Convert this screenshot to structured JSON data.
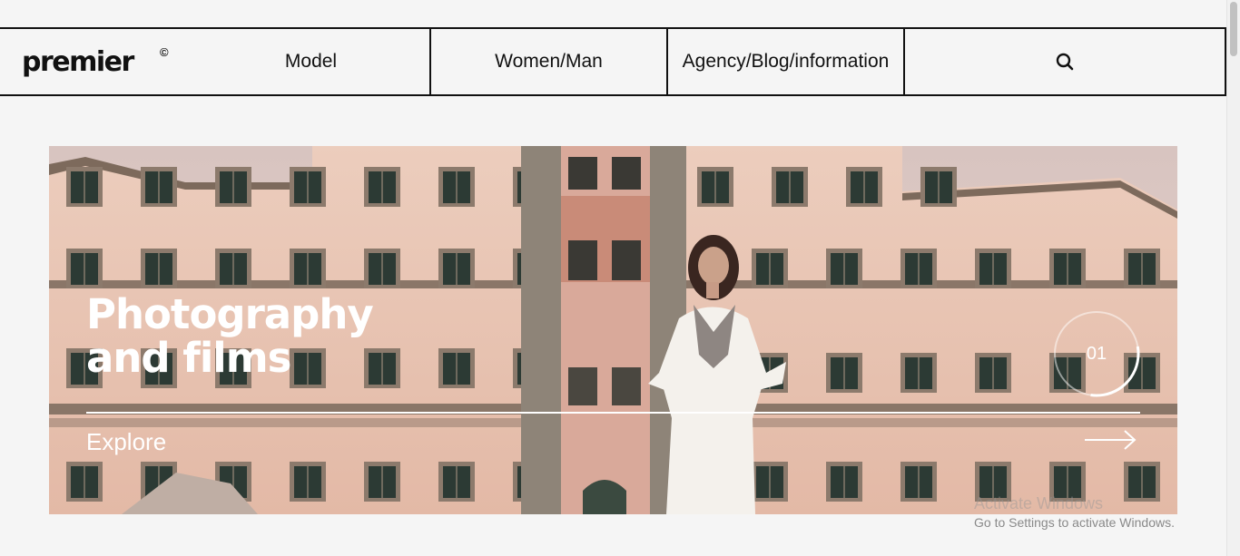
{
  "brand": {
    "name": "premier",
    "mark": "©"
  },
  "nav": {
    "model": "Model",
    "women_man": "Women/Man",
    "agency": "Agency/Blog/information",
    "search_icon": "search-icon"
  },
  "hero": {
    "title_line1": "Photography",
    "title_line2": "and films",
    "cta": "Explore",
    "slide_number": "01",
    "slide_progress": 0.3
  },
  "watermark": {
    "title": "Activate Windows",
    "subtitle": "Go to Settings to activate Windows."
  },
  "colors": {
    "background": "#f5f5f5",
    "border": "#111111",
    "hero_text": "#ffffff"
  }
}
